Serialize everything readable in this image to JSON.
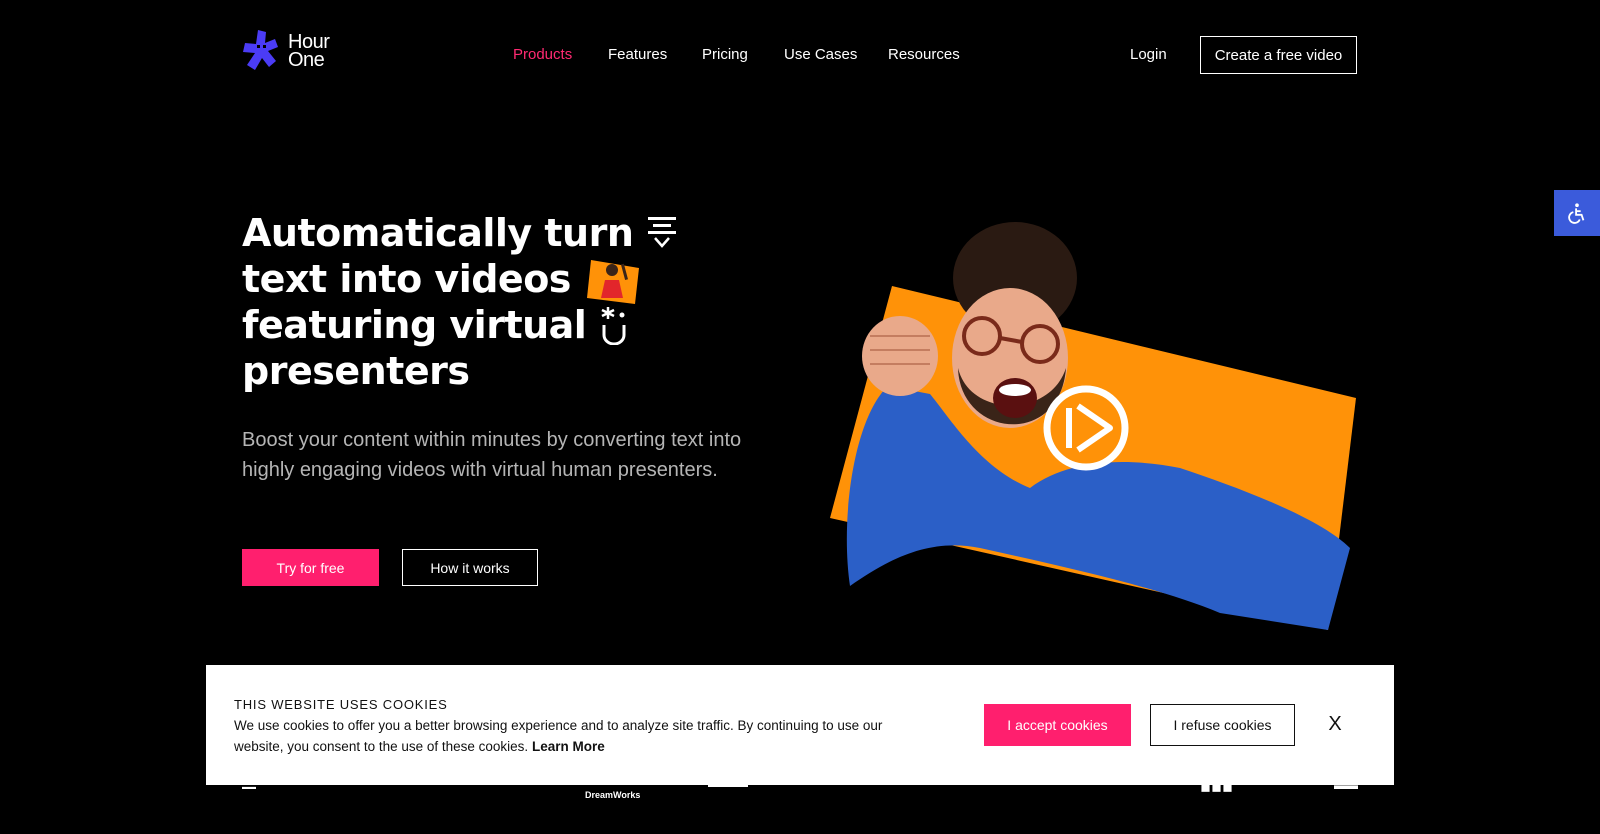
{
  "brand": {
    "name_line1": "Hour",
    "name_line2": "One",
    "logo_color": "#4b3cf5",
    "accent_color": "#ff1f6e"
  },
  "nav": {
    "items": [
      {
        "label": "Products",
        "active": true
      },
      {
        "label": "Features",
        "active": false
      },
      {
        "label": "Pricing",
        "active": false
      },
      {
        "label": "Use Cases",
        "active": false
      },
      {
        "label": "Resources",
        "active": false
      }
    ],
    "login": "Login",
    "cta": "Create a free video"
  },
  "accessibility": {
    "icon": "wheelchair-icon",
    "color": "#3b5bdb"
  },
  "hero": {
    "headline": {
      "line1": "Automatically turn",
      "line2": "text into videos",
      "line3": "featuring virtual",
      "line4": "presenters"
    },
    "headline_icons": [
      "text-lines-icon",
      "presenter-thumbnail",
      "smile-face-icon"
    ],
    "subtext": "Boost your content within minutes by converting text into highly engaging videos with virtual human presenters.",
    "primary_button": "Try for free",
    "secondary_button": "How it works",
    "media": {
      "icon": "play-icon",
      "backdrop_color": "#ff9208"
    }
  },
  "cookie_banner": {
    "title": "THIS WEBSITE USES COOKIES",
    "body": "We use cookies to offer you a better browsing experience and to analyze site traffic. By continuing to use our website, you consent to the use of these cookies.",
    "learn_more": "Learn More",
    "accept": "I accept cookies",
    "refuse": "I refuse cookies",
    "close": "X"
  },
  "partners": {
    "logos": [
      "DreamWorks"
    ]
  }
}
